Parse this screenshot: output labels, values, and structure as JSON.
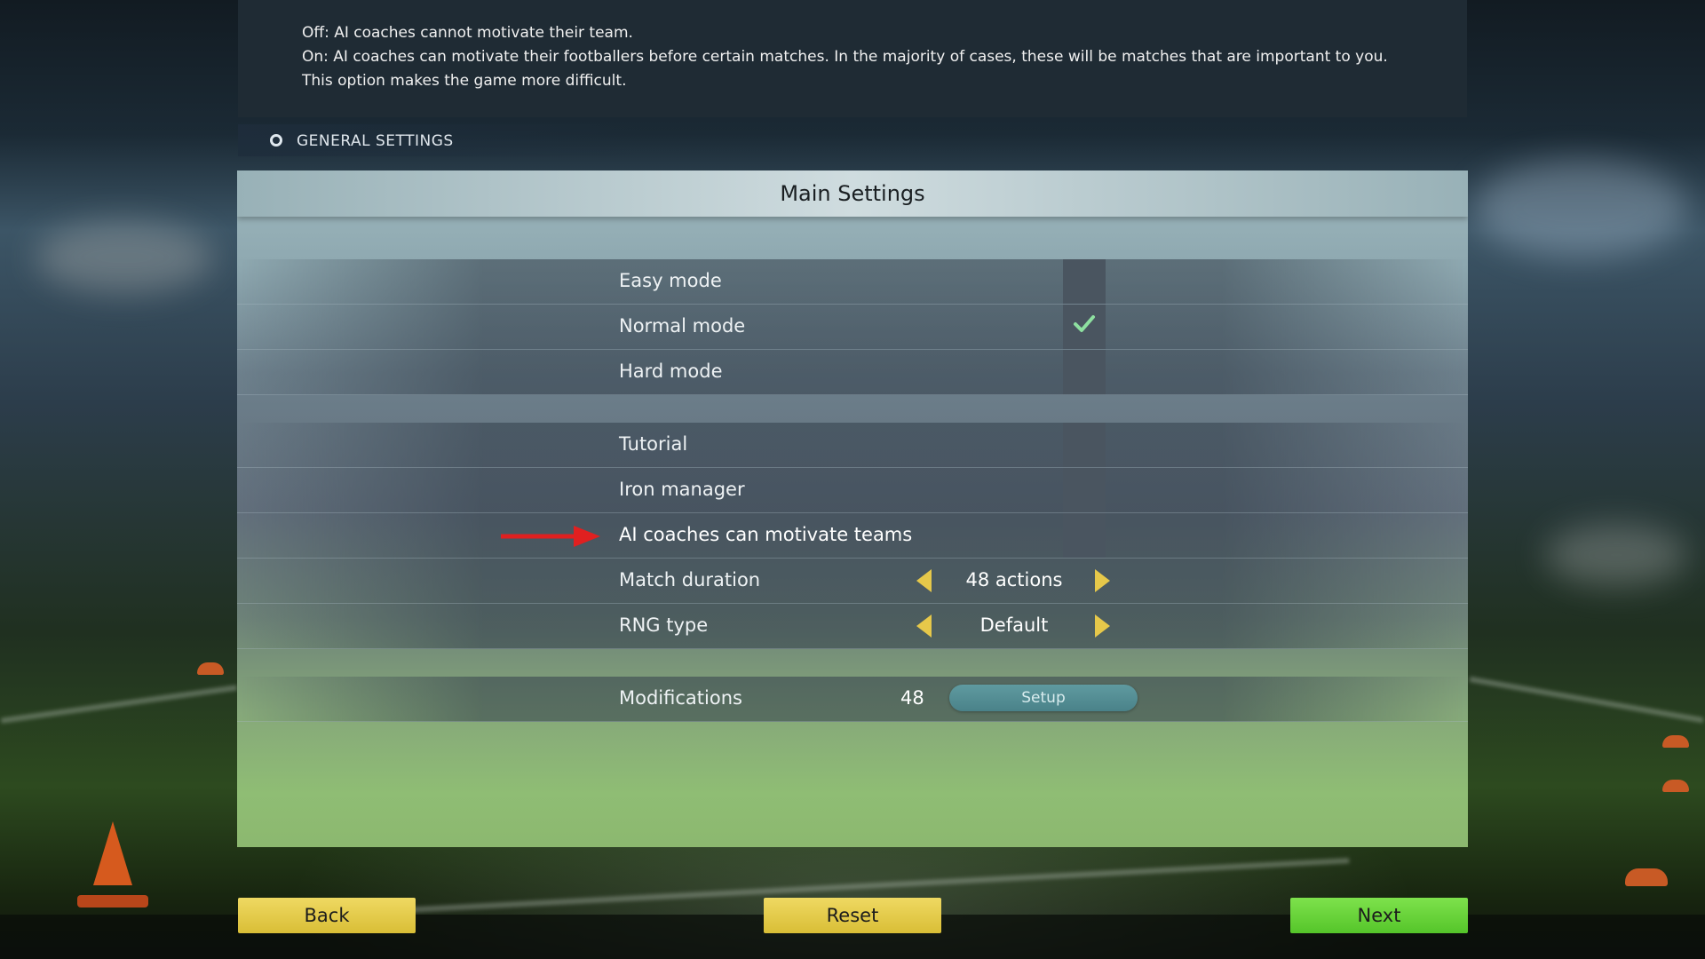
{
  "description": {
    "off_text": "Off: AI coaches cannot motivate their team.",
    "on_text": "On: AI coaches can motivate their footballers before certain matches. In the majority of cases, these will be matches that are important to you. This option makes the game more difficult."
  },
  "section": {
    "title": "GENERAL SETTINGS",
    "icon": "radio-icon"
  },
  "panel": {
    "title": "Main Settings",
    "difficulty": [
      {
        "label": "Easy mode",
        "checked": false
      },
      {
        "label": "Normal mode",
        "checked": true
      },
      {
        "label": "Hard mode",
        "checked": false
      }
    ],
    "options": [
      {
        "label": "Tutorial",
        "checked": false
      },
      {
        "label": "Iron manager",
        "checked": false
      },
      {
        "label": "AI coaches can motivate teams",
        "checked": false,
        "highlighted": true
      }
    ],
    "match_duration": {
      "label": "Match duration",
      "value": "48 actions"
    },
    "rng_type": {
      "label": "RNG type",
      "value": "Default"
    },
    "modifications": {
      "label": "Modifications",
      "count": "48",
      "button": "Setup"
    }
  },
  "footer": {
    "back": "Back",
    "reset": "Reset",
    "next": "Next"
  },
  "colors": {
    "accent_yellow": "#e6c84a",
    "next_green": "#6ad63b",
    "check_green": "#8ee0a0",
    "arrow_red": "#e02020"
  }
}
